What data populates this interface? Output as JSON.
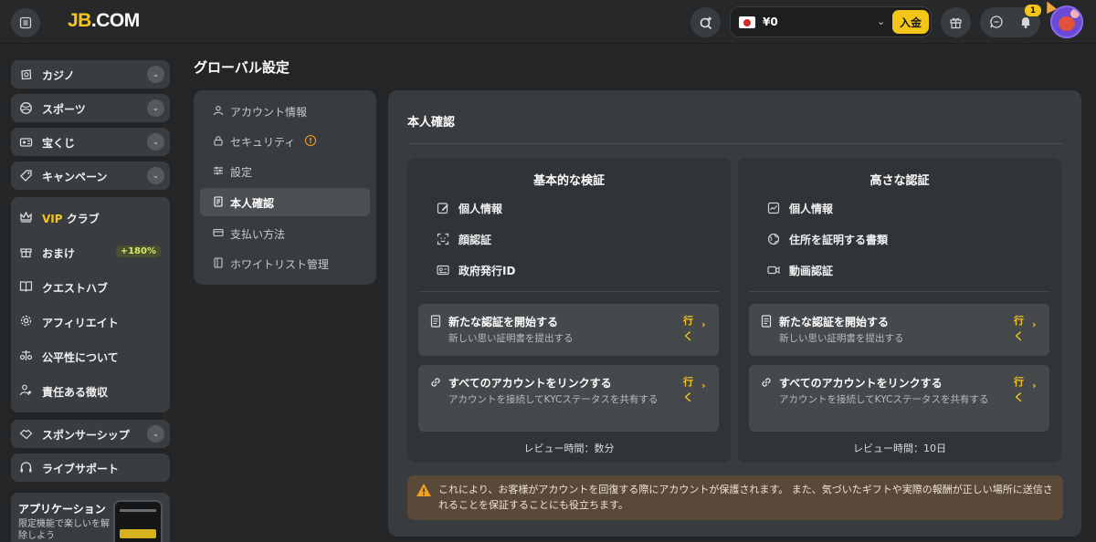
{
  "header": {
    "logo_left": "JB",
    "logo_right": ".COM",
    "wallet": {
      "balance": "¥0",
      "deposit_label": "入金"
    },
    "notification_count": "1",
    "colors": {
      "accent": "#f5c518",
      "avatar": "#6b4bd6"
    }
  },
  "sidebar": {
    "top_items": [
      {
        "label": "カジノ",
        "icon": "casino-chip-icon"
      },
      {
        "label": "スポーツ",
        "icon": "sports-ball-icon"
      },
      {
        "label": "宝くじ",
        "icon": "lottery-ticket-icon"
      },
      {
        "label": "キャンペーン",
        "icon": "tag-icon"
      }
    ],
    "group_items": [
      {
        "label_prefix": "VIP",
        "label": " クラブ",
        "icon": "crown-icon"
      },
      {
        "label": "おまけ",
        "icon": "gift-icon",
        "badge": "+180%"
      },
      {
        "label": "クエストハブ",
        "icon": "book-icon"
      },
      {
        "label": "アフィリエイト",
        "icon": "gear-icon"
      },
      {
        "label": "公平性について",
        "icon": "scales-icon"
      },
      {
        "label": "責任ある徴収",
        "icon": "person-heart-icon"
      }
    ],
    "sponsorship": {
      "label": "スポンサーシップ",
      "icon": "handshake-icon"
    },
    "live_support": {
      "label": "ライブサポート",
      "icon": "headset-icon"
    },
    "app_card": {
      "title": "アプリケーション",
      "subtitle": "限定機能で楽しいを解除しよう"
    }
  },
  "page": {
    "title": "グローバル設定"
  },
  "settings_nav": {
    "items": [
      {
        "label": "アカウント情報",
        "icon": "user-icon"
      },
      {
        "label": "セキュリティ",
        "icon": "lock-icon",
        "warning": "!"
      },
      {
        "label": "設定",
        "icon": "sliders-icon"
      },
      {
        "label": "本人確認",
        "icon": "id-document-icon",
        "active": true
      },
      {
        "label": "支払い方法",
        "icon": "card-icon"
      },
      {
        "label": "ホワイトリスト管理",
        "icon": "list-doc-icon"
      }
    ]
  },
  "verification": {
    "section_title": "本人確認",
    "basic": {
      "title": "基本的な検証",
      "requirements": [
        "個人情報",
        "顔認証",
        "政府発行ID"
      ],
      "actions": [
        {
          "title": "新たな認証を開始する",
          "subtitle": "新しい思い証明書を提出する",
          "go": "行く"
        },
        {
          "title": "すべてのアカウントをリンクする",
          "subtitle": "アカウントを接続してKYCステータスを共有する",
          "go": "行く"
        }
      ],
      "review_time": "レビュー時間：数分"
    },
    "advanced": {
      "title": "高さな認証",
      "requirements": [
        "個人情報",
        "住所を証明する書類",
        "動画認証"
      ],
      "actions": [
        {
          "title": "新たな認証を開始する",
          "subtitle": "新しい思い証明書を提出する",
          "go": "行く"
        },
        {
          "title": "すべてのアカウントをリンクする",
          "subtitle": "アカウントを接続してKYCステータスを共有する",
          "go": "行く"
        }
      ],
      "review_time": "レビュー時間：10日"
    },
    "notice": "これにより、お客様がアカウントを回復する際にアカウントが保護されます。 また、気づいたギフトや実際の報酬が正しい場所に送信されることを保証することにも役立ちます。"
  }
}
